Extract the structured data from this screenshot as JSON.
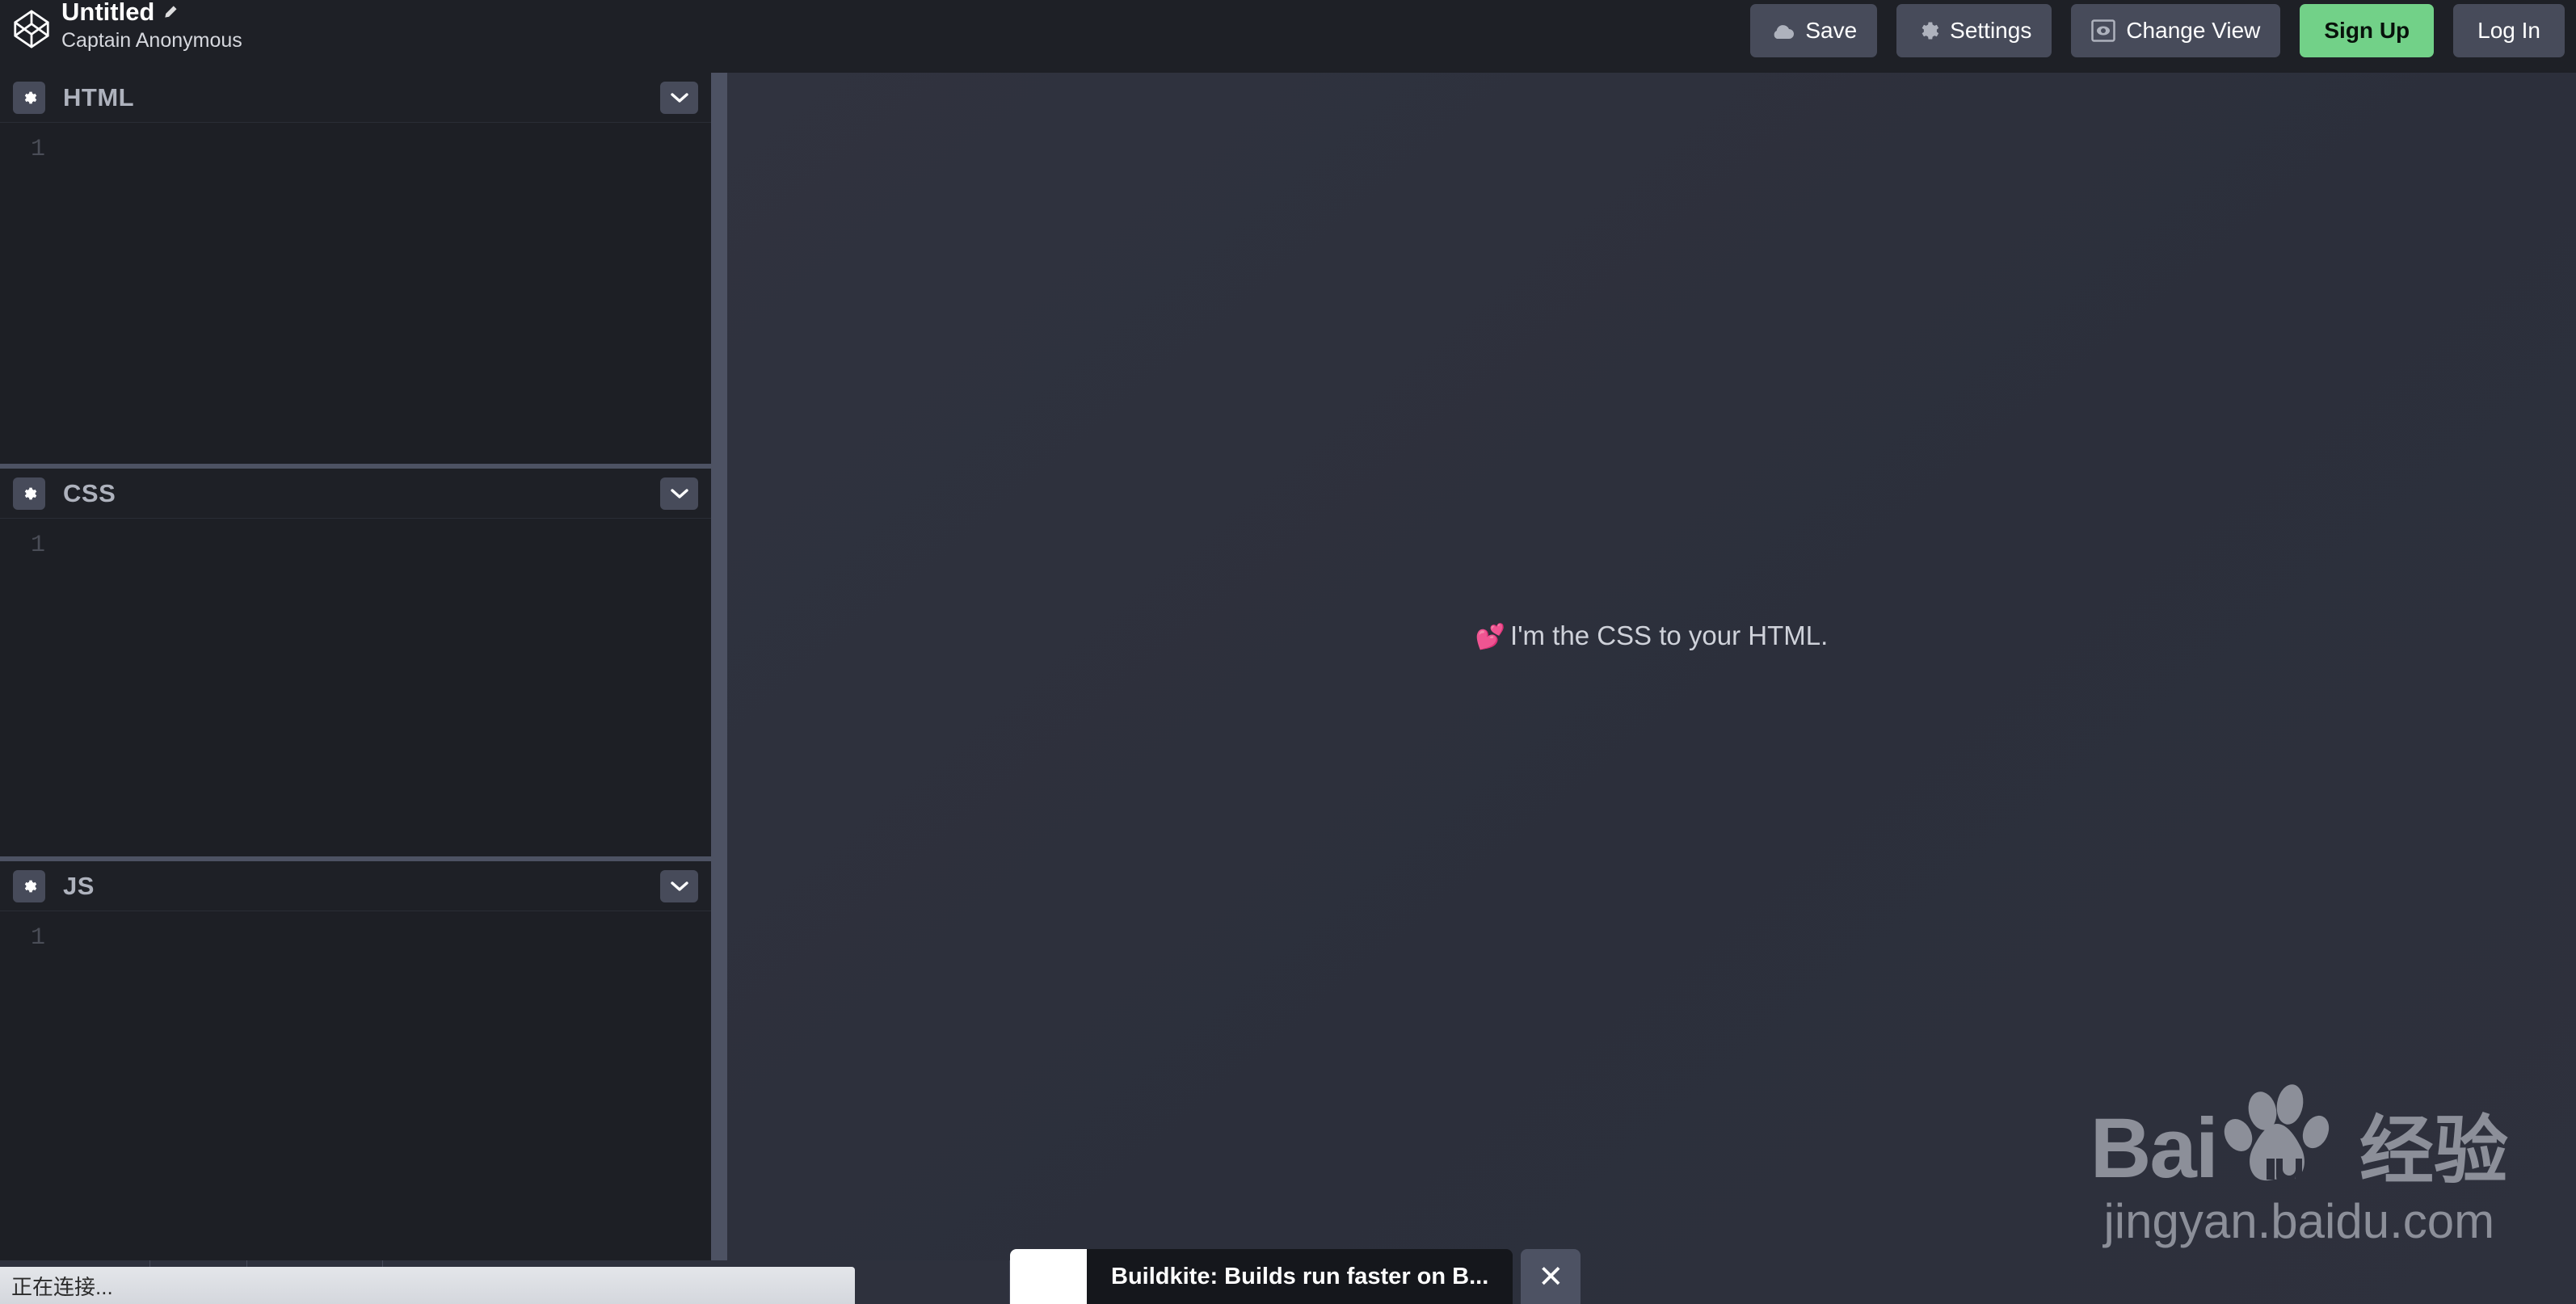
{
  "topbar": {
    "logo_icon": "codepen-logo-icon",
    "pen_title": "Untitled",
    "edit_icon": "pencil-icon",
    "author": "Captain Anonymous",
    "buttons": [
      {
        "label": "Save",
        "icon": "cloud-icon",
        "style": "default"
      },
      {
        "label": "Settings",
        "icon": "gear-icon",
        "style": "default"
      },
      {
        "label": "Change View",
        "icon": "eye-frame-icon",
        "style": "default"
      },
      {
        "label": "Sign Up",
        "icon": "",
        "style": "primary"
      },
      {
        "label": "Log In",
        "icon": "",
        "style": "default"
      }
    ]
  },
  "editors": [
    {
      "title": "HTML",
      "gear_icon": "gear-icon",
      "collapse_icon": "chevron-down-icon",
      "line_number": "1",
      "code": ""
    },
    {
      "title": "CSS",
      "gear_icon": "gear-icon",
      "collapse_icon": "chevron-down-icon",
      "line_number": "1",
      "code": ""
    },
    {
      "title": "JS",
      "gear_icon": "gear-icon",
      "collapse_icon": "chevron-down-icon",
      "line_number": "1",
      "code": ""
    }
  ],
  "preview": {
    "hearts_emoji": "💕",
    "message": "I'm the CSS to your HTML."
  },
  "watermark": {
    "brand_bai": "Bai",
    "brand_du": "du",
    "brand_cn": "经验",
    "url": "jingyan.baidu.com",
    "paw_icon": "baidu-paw-icon"
  },
  "ad": {
    "text": "Buildkite: Builds run faster on B...",
    "close_icon": "close-icon"
  },
  "browser": {
    "status_text": "正在连接..."
  },
  "colors": {
    "topbar_bg": "#1e2026",
    "editor_bg": "#1d1f25",
    "preview_bg": "#2e313d",
    "button_bg": "#474b5a",
    "signup_green": "#72d188",
    "divider": "#4d5263",
    "pane_title": "#aeb2bd",
    "line_number": "#4a4d57"
  }
}
